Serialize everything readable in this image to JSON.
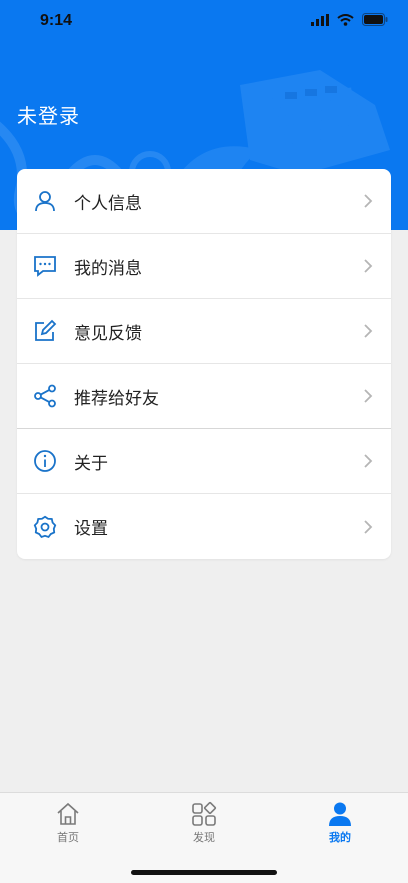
{
  "status": {
    "time": "9:14"
  },
  "profile": {
    "login_label": "未登录"
  },
  "menu": [
    {
      "label": "个人信息",
      "icon": "person-icon"
    },
    {
      "label": "我的消息",
      "icon": "message-icon"
    },
    {
      "label": "意见反馈",
      "icon": "edit-icon"
    },
    {
      "label": "推荐给好友",
      "icon": "share-icon"
    },
    {
      "label": "关于",
      "icon": "info-icon"
    },
    {
      "label": "设置",
      "icon": "settings-icon"
    }
  ],
  "tabs": [
    {
      "label": "首页",
      "icon": "home-icon"
    },
    {
      "label": "发现",
      "icon": "discover-icon"
    },
    {
      "label": "我的",
      "icon": "profile-icon",
      "active": true
    }
  ],
  "colors": {
    "brand": "#0a78f0",
    "icon": "#1a73c9",
    "chevron": "#b5b5b5"
  }
}
